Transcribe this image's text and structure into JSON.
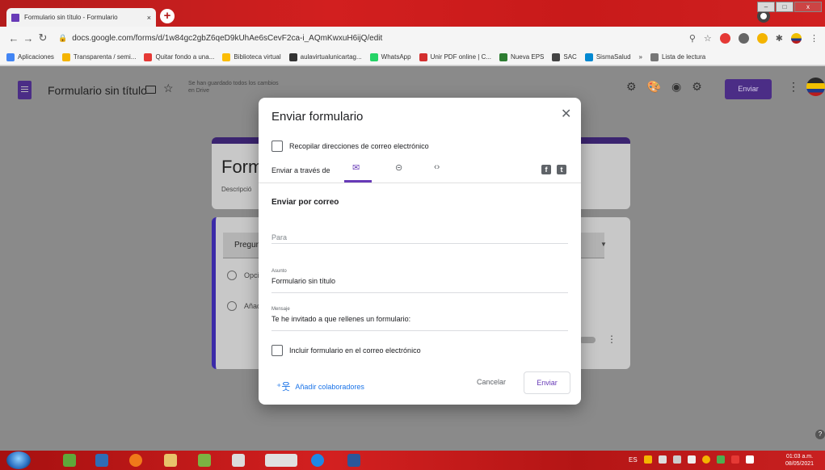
{
  "browser": {
    "tab_title": "Formulario sin título - Formulario",
    "tab_close": "×",
    "new_tab": "+",
    "url": "docs.google.com/forms/d/1w84gc2gbZ6qeD9kUhAe6sCevF2ca-i_AQmKwxuH6ijQ/edit",
    "bookmarks": [
      {
        "label": "Aplicaciones",
        "color": "#4285f4"
      },
      {
        "label": "Transparenta / semi...",
        "color": "#f4b400"
      },
      {
        "label": "Quitar fondo a una...",
        "color": "#e53935"
      },
      {
        "label": "Biblioteca virtual",
        "color": "#fbbc04"
      },
      {
        "label": "aulavirtualunicartag...",
        "color": "#333333"
      },
      {
        "label": "WhatsApp",
        "color": "#25d366"
      },
      {
        "label": "Unir PDF online | C...",
        "color": "#d32f2f"
      },
      {
        "label": "Nueva EPS",
        "color": "#2e7d32"
      },
      {
        "label": "SAC",
        "color": "#444444"
      },
      {
        "label": "SismaSalud",
        "color": "#0288d1"
      }
    ],
    "bookmarks_more": "»",
    "reading_list": "Lista de lectura"
  },
  "forms_header": {
    "title": "Formulario sin título",
    "save_status": "Se han guardado todos los cambios en Drive",
    "send_label": "Enviar",
    "accent_color": "#4b2d86"
  },
  "form_canvas": {
    "title_partial": "Form",
    "description_partial": "Descripció",
    "question_partial": "Pregun",
    "option1_partial": "Opció",
    "option2_partial": "Añadi"
  },
  "dialog": {
    "title": "Enviar formulario",
    "collect_emails_label": "Recopilar direcciones de correo electrónico",
    "send_via_label": "Enviar a través de",
    "section_title": "Enviar por correo",
    "to_placeholder": "Para",
    "subject_label": "Asunto",
    "subject_value": "Formulario sin título",
    "message_label": "Mensaje",
    "message_value": "Te he invitado a que rellenes un formulario:",
    "include_form_label": "Incluir formulario en el correo electrónico",
    "add_collaborators": "Añadir colaboradores",
    "cancel_label": "Cancelar",
    "send_label": "Enviar"
  },
  "taskbar": {
    "language": "ES",
    "time": "01:03 a.m.",
    "date": "08/05/2021"
  }
}
